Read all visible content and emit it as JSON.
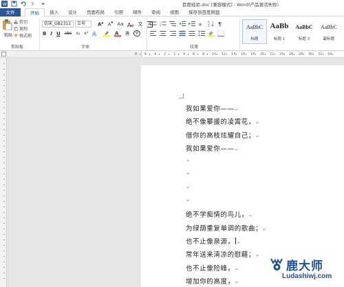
{
  "window": {
    "title_doc": "百度经验.doc [兼容模式]",
    "title_app": "- Word(产品激活失败)"
  },
  "tabs": {
    "file": "文件",
    "items": [
      "开始",
      "插入",
      "设计",
      "页面布局",
      "引用",
      "邮件",
      "审阅",
      "视图",
      "保存到百度网盘"
    ],
    "active_index": 0
  },
  "clipboard": {
    "paste": "粘贴",
    "cut": "剪切",
    "copy": "复制",
    "format_painter": "格式刷",
    "group_label": "剪贴板"
  },
  "font": {
    "name": "仿宋_GB2312",
    "size": "三号",
    "group_label": "字体",
    "buttons": [
      "B",
      "I",
      "U",
      "abc",
      "x₂",
      "x²"
    ]
  },
  "paragraph": {
    "group_label": "段落"
  },
  "styles": {
    "items": [
      {
        "sample": "AaBbC",
        "name": "标题"
      },
      {
        "sample": "AaBb",
        "name": "标题 1"
      },
      {
        "sample": "AaBbC",
        "name": "标题 3"
      },
      {
        "sample": "AaBbC",
        "name": "副标题"
      }
    ]
  },
  "ruler": {
    "numbers": [
      "8",
      "6",
      "4",
      "2",
      "2",
      "4",
      "6",
      "8",
      "10",
      "12",
      "14",
      "16",
      "18",
      "20",
      "22",
      "24",
      "26",
      "28",
      "30",
      "32",
      "34"
    ]
  },
  "document": {
    "lines": [
      "我如果爱你——",
      "绝不像攀援的凌霄花，",
      "借你的高枝炫耀自己；",
      "我如果爱你——",
      "",
      "",
      "",
      "",
      "绝不学痴情的鸟儿，",
      "为绿荫重复单调的歌曲；",
      "也不止像泉源，",
      "常年送来清凉的慰藉；",
      "也不止像险峰，",
      "增加你的高度，"
    ],
    "cursor_line": 10
  },
  "watermark": {
    "name": "鹿大师",
    "url": "Ludashiwj.com"
  },
  "colors": {
    "accent": "#2b579a",
    "watermark": "#1f4f8f"
  }
}
